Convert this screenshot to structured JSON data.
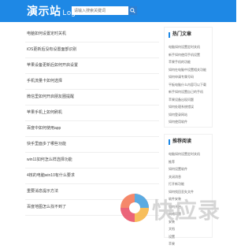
{
  "header": {
    "logo_main": "演示站",
    "logo_sub": "Logo",
    "search_placeholder": "请输入搜索关键词",
    "bg_color": "#1e88e5"
  },
  "articles": [
    "电脑如何设置定时关机",
    "iOS更新后没有设置面部识别",
    "苹果设备更新后如何开启设置",
    "手机流量卡如何选择",
    "微信里如何开启朋友圈提醒",
    "苹果手机上如何刷机",
    "百度中如何使用app",
    "快手里面多了哪些功能",
    "win11如何怎么样选择功能",
    "4核的电脑win10有什么要求",
    "重要消息提示方法",
    "百度地图怎么找不到了"
  ],
  "sidebar": {
    "box1_title": "热门文章",
    "box1_items": [
      "电脑如何设置定时关机",
      "新手如何使用手机设置",
      "苹果手机的功能",
      "如何在电脑中设置相关功能",
      "如何申请专属号码",
      "平板电脑什么内容可以下载",
      "新手如何设置自己的手机",
      "苹果设备出现问题",
      "如何处理系统错误",
      "如何登录网站",
      "如何使用软件"
    ],
    "box2_title": "推荐阅读",
    "box2_items": [
      "电脑如何设置定时关机",
      "推荐",
      "如何设置软件",
      "关闭消息",
      "打开新功能",
      "如何找回丢失文件",
      "软件安装",
      "如何开启",
      "网络问题",
      "安装",
      "文档",
      "设置",
      "苹果"
    ]
  },
  "watermark": {
    "text": "快应录",
    "logo": "quick-app-logo"
  }
}
